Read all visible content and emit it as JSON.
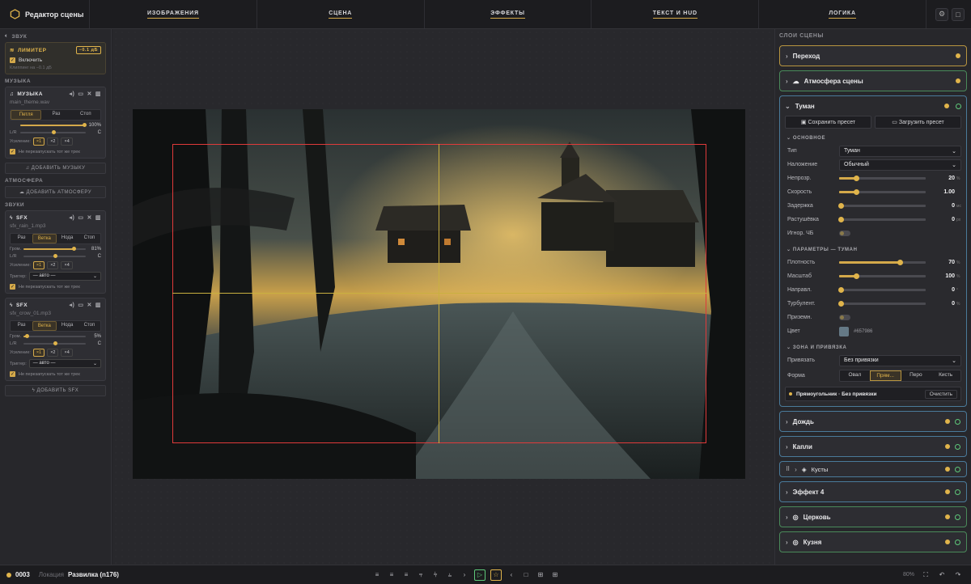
{
  "app": {
    "title": "Редактор сцены"
  },
  "nav": {
    "tabs": [
      "ИЗОБРАЖЕНИЯ",
      "СЦЕНА",
      "ЭФФЕКТЫ",
      "ТЕКСТ И HUD",
      "ЛОГИКА"
    ]
  },
  "left": {
    "sound_header": "ЗВУК",
    "limiter": {
      "title": "ЛИМИТЕР",
      "badge": "−0.1 дБ",
      "enable": "Включить",
      "note": "Клиппинг на −0.1 дБ"
    },
    "music_header": "МУЗЫКА",
    "music": {
      "title": "МУЗЫКА",
      "file": "main_theme.wav",
      "modes": [
        "Петля",
        "Раз",
        "Стоп"
      ],
      "active_mode": 0,
      "volume_value": "100%",
      "volume_level": 0.97,
      "pan_left": "L/R",
      "pan_right": "C",
      "pan_level": 0.5,
      "gain_label": "Усиление:",
      "gains": [
        "×1",
        "×2",
        "×4"
      ],
      "no_restart": "Не перезапускать тот же трек"
    },
    "add_music": "ДОБАВИТЬ МУЗЫКУ",
    "atmo_header": "АТМОСФЕРА",
    "add_atmo": "ДОБАВИТЬ АТМОСФЕРУ",
    "sounds_header": "ЗВУКИ",
    "sfx": [
      {
        "title": "SFX",
        "file": "sfx_rain_1.mp3",
        "modes": [
          "Раз",
          "Ветка",
          "Нода",
          "Стоп"
        ],
        "active_mode": 1,
        "vol_label": "Гром.",
        "volume_value": "81%",
        "volume_level": 0.81,
        "pan_label": "L/R",
        "pan_right": "C",
        "pan_level": 0.5,
        "gain_label": "Усиление:",
        "gains": [
          "×1",
          "×2",
          "×4"
        ],
        "trigger_label": "Триггер:",
        "trigger_value": "— авто —",
        "no_restart": "Не перезапускать тот же трек"
      },
      {
        "title": "SFX",
        "file": "sfx_crow_01.mp3",
        "modes": [
          "Раз",
          "Ветка",
          "Нода",
          "Стоп"
        ],
        "active_mode": 1,
        "vol_label": "Гром.",
        "volume_value": "5%",
        "volume_level": 0.05,
        "pan_label": "L/R",
        "pan_right": "C",
        "pan_level": 0.5,
        "gain_label": "Усиление:",
        "gains": [
          "×1",
          "×2",
          "×4"
        ],
        "trigger_label": "Триггер:",
        "trigger_value": "— авто —",
        "no_restart": "Не перезапускать тот же трек"
      }
    ],
    "add_sfx": "ДОБАВИТЬ SFX"
  },
  "right": {
    "header": "СЛОИ СЦЕНЫ",
    "layers_top": [
      {
        "name": "Переход",
        "style": "gold",
        "ring": false
      },
      {
        "name": "Атмосфера сцены",
        "style": "green",
        "ring": false
      }
    ],
    "fog": {
      "name": "Туман",
      "save_preset": "Сохранить пресет",
      "load_preset": "Загрузить пресет",
      "basic_header": "ОСНОВНОЕ",
      "type_label": "Тип",
      "type_value": "Туман",
      "blend_label": "Наложение",
      "blend_value": "Обычный",
      "opacity_label": "Непрозр.",
      "opacity_value": "20",
      "opacity_unit": "%",
      "opacity_level": 0.2,
      "speed_label": "Скорость",
      "speed_value": "1.00",
      "speed_level": 0.2,
      "delay_label": "Задержка",
      "delay_value": "0",
      "delay_unit": "мс",
      "delay_level": 0.0,
      "feather_label": "Растушёвка",
      "feather_value": "0",
      "feather_unit": "px",
      "feather_level": 0.0,
      "ignore_bw_label": "Игнор. ЧБ",
      "params_header": "ПАРАМЕТРЫ — ТУМАН",
      "density_label": "Плотность",
      "density_value": "70",
      "density_unit": "%",
      "density_level": 0.7,
      "scale_label": "Масштаб",
      "scale_value": "100",
      "scale_unit": "%",
      "scale_level": 0.2,
      "dir_label": "Направл.",
      "dir_value": "0",
      "dir_unit": "°",
      "dir_level": 0.0,
      "turb_label": "Турбулент.",
      "turb_value": "0",
      "turb_unit": "%",
      "turb_level": 0.0,
      "ground_label": "Приземн.",
      "color_label": "Цвет",
      "color_value": "#657986",
      "zone_header": "ЗОНА И ПРИВЯЗКА",
      "bind_label": "Привязать",
      "bind_value": "Без привязки",
      "shape_label": "Форма",
      "shapes": [
        "Овал",
        "Прям...",
        "Перо",
        "Кисть"
      ],
      "active_shape": 1,
      "status_text": "Прямоугольник · Без привязки",
      "clear_label": "Очистить"
    },
    "layers_bottom": [
      {
        "name": "Дождь",
        "style": "blue",
        "ring": true
      },
      {
        "name": "Капли",
        "style": "blue",
        "ring": true
      },
      {
        "name": "Кусты",
        "style": "blue",
        "ring": true
      },
      {
        "name": "Эффект 4",
        "style": "blue",
        "ring": true
      },
      {
        "name": "Церковь",
        "style": "green",
        "ring": true
      },
      {
        "name": "Кузня",
        "style": "green",
        "ring": true
      }
    ]
  },
  "bottom": {
    "id": "0003",
    "location_label": "Локация",
    "location_value": "Развилка (n176)",
    "zoom": "80%"
  },
  "colors": {
    "accent": "#e0b44b",
    "fog": "#657986",
    "green": "#5ec97a"
  }
}
